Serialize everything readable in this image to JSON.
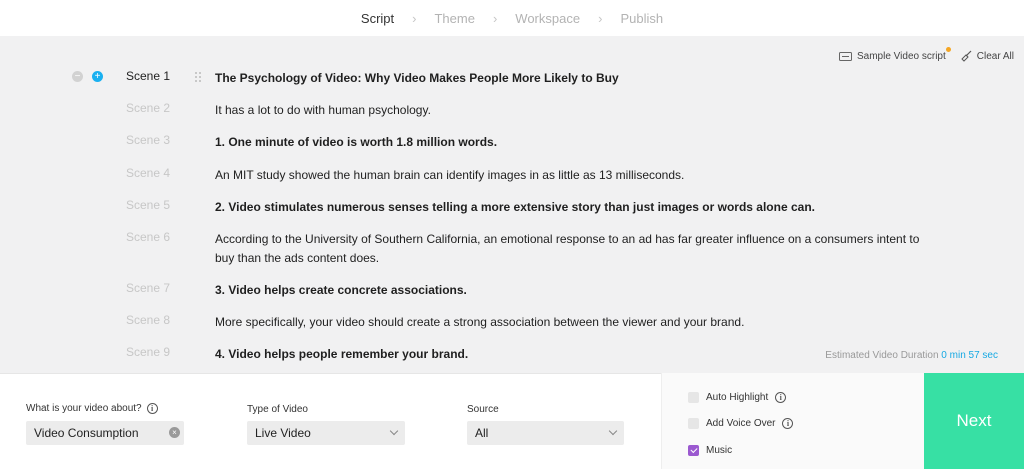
{
  "stepper": {
    "steps": [
      {
        "label": "Script"
      },
      {
        "label": "Theme"
      },
      {
        "label": "Workspace"
      },
      {
        "label": "Publish"
      }
    ]
  },
  "tools": {
    "sample_label": "Sample Video script",
    "clear_label": "Clear All"
  },
  "scenes": [
    {
      "label": "Scene 1",
      "text": "The Psychology of Video: Why Video Makes People More Likely to Buy"
    },
    {
      "label": "Scene 2",
      "text": "It has a lot to do with human psychology."
    },
    {
      "label": "Scene 3",
      "text": "1. One minute of video is worth 1.8 million words."
    },
    {
      "label": "Scene 4",
      "text": "An MIT study showed the human brain can identify images in as little as 13 milliseconds."
    },
    {
      "label": "Scene 5",
      "text": "2. Video stimulates numerous senses telling a more extensive story than just images or words alone can."
    },
    {
      "label": "Scene 6",
      "text": "According to the University of Southern California, an emotional response to an ad has far greater influence on a consumers intent to buy than the ads content does."
    },
    {
      "label": "Scene 7",
      "text": "3. Video helps create concrete associations."
    },
    {
      "label": "Scene 8",
      "text": "More specifically, your video should create a strong association between the viewer and your brand."
    },
    {
      "label": "Scene 9",
      "text": "4. Video helps people remember your brand."
    }
  ],
  "duration": {
    "label": "Estimated Video Duration",
    "value": "0 min 57 sec"
  },
  "form": {
    "about_label": "What is your video about?",
    "about_value": "Video Consumption",
    "type_label": "Type of Video",
    "type_value": "Live Video",
    "source_label": "Source",
    "source_value": "All"
  },
  "options": {
    "auto_highlight": "Auto Highlight",
    "voice_over": "Add Voice Over",
    "music": "Music"
  },
  "next_label": "Next",
  "colors": {
    "accent_green": "#37e0a4",
    "accent_blue": "#17a9e3",
    "checkbox_purple": "#9b59d0"
  }
}
